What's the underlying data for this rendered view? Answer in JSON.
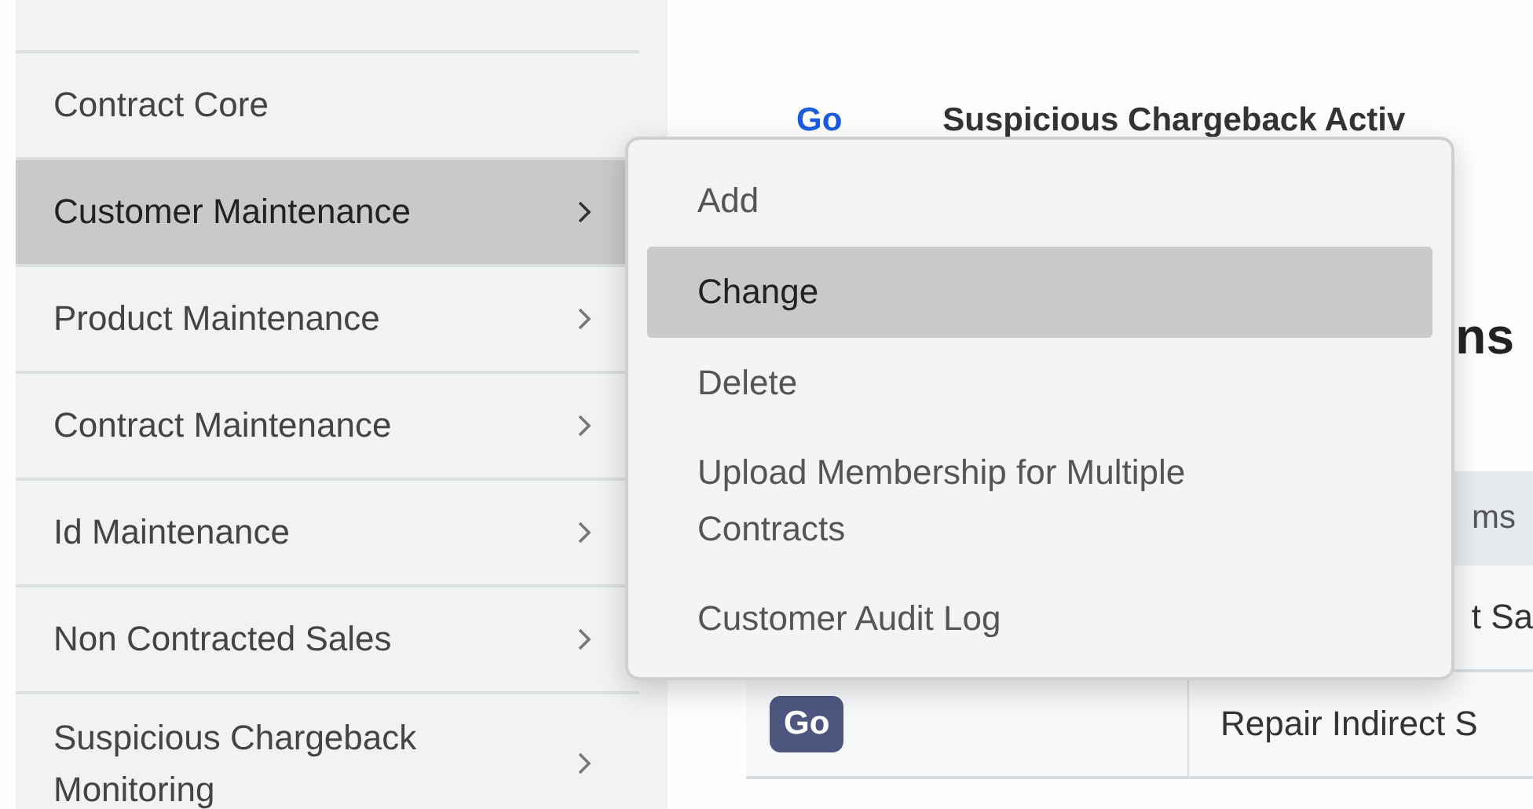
{
  "sidebar": {
    "items": [
      {
        "label": "Contract Core",
        "selected": false,
        "has_submenu": false
      },
      {
        "label": "Customer Maintenance",
        "selected": true,
        "has_submenu": true
      },
      {
        "label": "Product Maintenance",
        "selected": false,
        "has_submenu": true
      },
      {
        "label": "Contract Maintenance",
        "selected": false,
        "has_submenu": true
      },
      {
        "label": "Id Maintenance",
        "selected": false,
        "has_submenu": true
      },
      {
        "label": "Non Contracted Sales",
        "selected": false,
        "has_submenu": true
      },
      {
        "label": "Suspicious Chargeback Monitoring",
        "selected": false,
        "has_submenu": true
      }
    ]
  },
  "submenu": {
    "items": [
      {
        "label": "Add",
        "selected": false
      },
      {
        "label": "Change",
        "selected": true
      },
      {
        "label": "Delete",
        "selected": false
      },
      {
        "label": "Upload Membership for Multiple Contracts",
        "selected": false
      },
      {
        "label": "Customer Audit Log",
        "selected": false
      }
    ]
  },
  "content": {
    "link_row": {
      "link": "Go",
      "title": "Suspicious Chargeback Activ"
    },
    "heading_fragment": "ns",
    "table": {
      "header_fragment": "ms",
      "rows": [
        {
          "button": null,
          "cell": "t Sa"
        },
        {
          "button": "Go",
          "cell": "Repair Indirect S"
        }
      ]
    }
  }
}
